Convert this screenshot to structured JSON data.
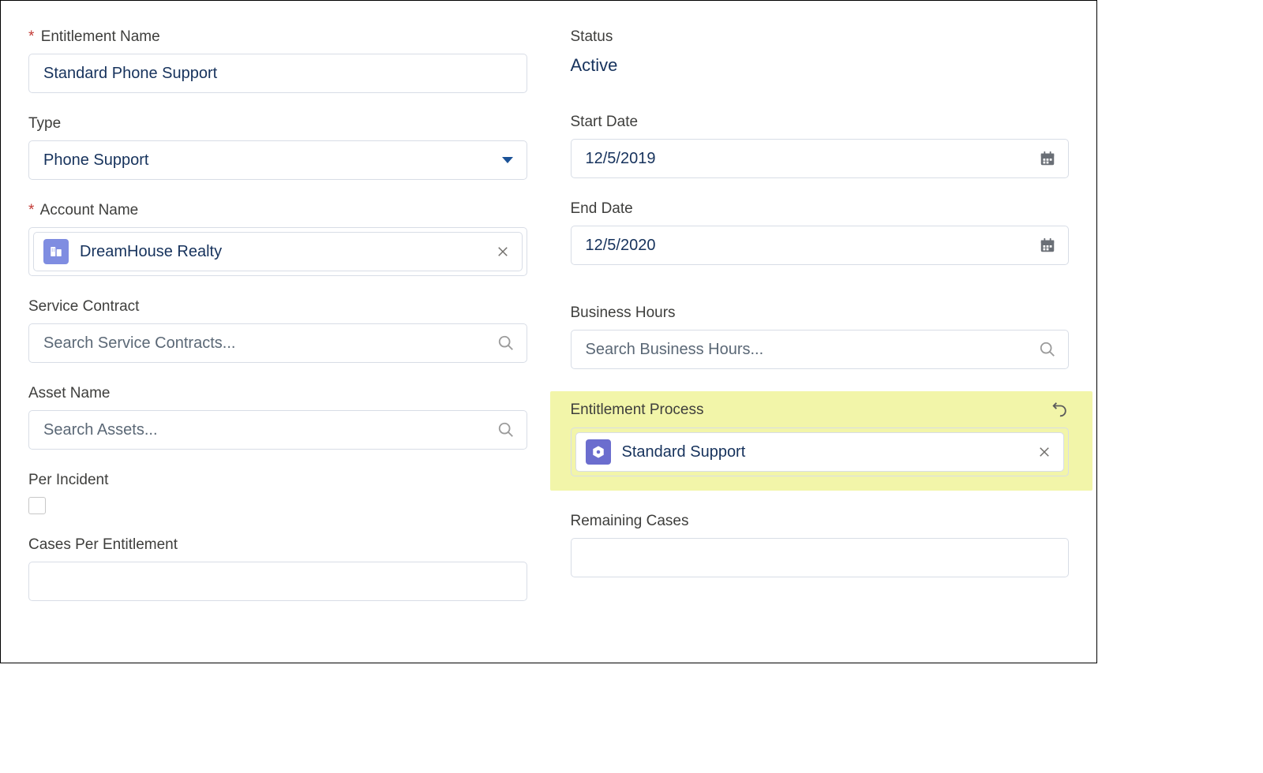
{
  "left": {
    "entitlement_name": {
      "label": "Entitlement Name",
      "value": "Standard Phone Support",
      "required": true
    },
    "type": {
      "label": "Type",
      "value": "Phone Support"
    },
    "account_name": {
      "label": "Account Name",
      "value": "DreamHouse Realty",
      "required": true
    },
    "service_contract": {
      "label": "Service Contract",
      "placeholder": "Search Service Contracts..."
    },
    "asset_name": {
      "label": "Asset Name",
      "placeholder": "Search Assets..."
    },
    "per_incident": {
      "label": "Per Incident",
      "checked": false
    },
    "cases_per_entitlement": {
      "label": "Cases Per Entitlement",
      "value": ""
    }
  },
  "right": {
    "status": {
      "label": "Status",
      "value": "Active"
    },
    "start_date": {
      "label": "Start Date",
      "value": "12/5/2019"
    },
    "end_date": {
      "label": "End Date",
      "value": "12/5/2020"
    },
    "business_hours": {
      "label": "Business Hours",
      "placeholder": "Search Business Hours..."
    },
    "entitlement_process": {
      "label": "Entitlement Process",
      "value": "Standard Support"
    },
    "remaining_cases": {
      "label": "Remaining Cases",
      "value": ""
    }
  }
}
